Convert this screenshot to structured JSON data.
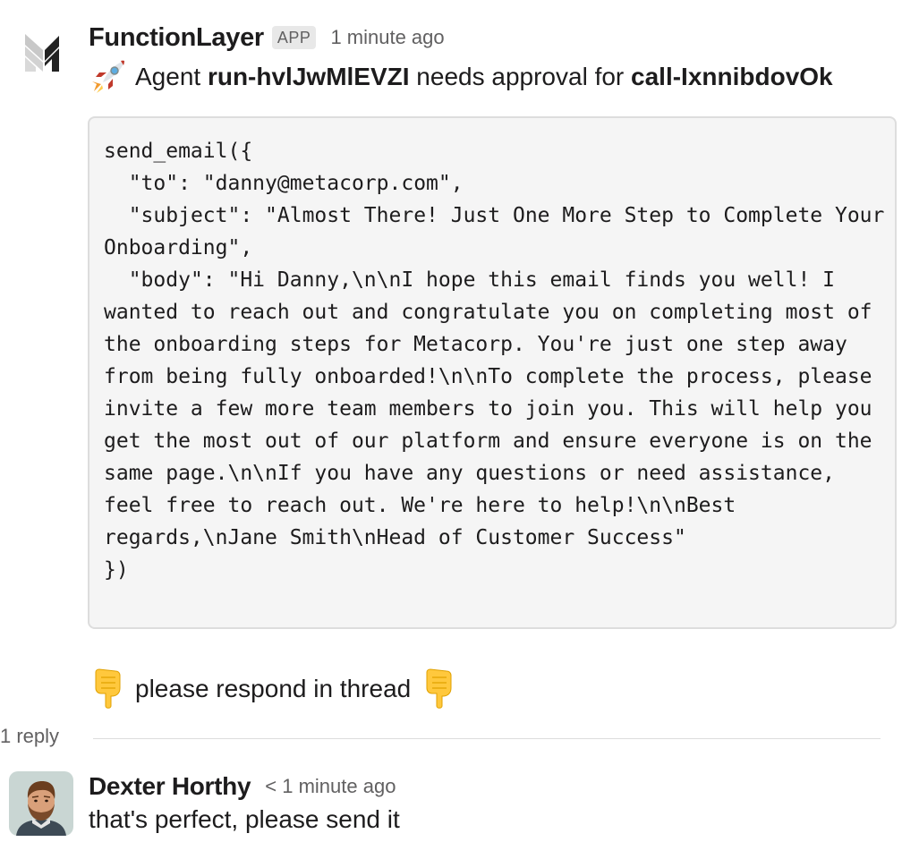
{
  "app_message": {
    "sender": "FunctionLayer",
    "badge": "APP",
    "timestamp": "1 minute ago",
    "avatar_icon": "functionlayer-logo-icon",
    "text": {
      "emoji": "rocket-icon",
      "prefix": "Agent ",
      "run_id": "run-hvlJwMlEVZI",
      "middle": " needs approval for ",
      "call_id": "call-IxnnibdovOk"
    },
    "code": "send_email({\n  \"to\": \"danny@metacorp.com\",\n  \"subject\": \"Almost There! Just One More Step to Complete Your Onboarding\",\n  \"body\": \"Hi Danny,\\n\\nI hope this email finds you well! I wanted to reach out and congratulate you on completing most of the onboarding steps for Metacorp. You're just one step away from being fully onboarded!\\n\\nTo complete the process, please invite a few more team members to join you. This will help you get the most out of our platform and ensure everyone is on the same page.\\n\\nIf you have any questions or need assistance, feel free to reach out. We're here to help!\\n\\nBest regards,\\nJane Smith\\nHead of Customer Success\"\n})",
    "respond_prompt": "please respond in thread",
    "respond_emoji": "pointing-down-hand-icon"
  },
  "thread": {
    "reply_count": "1 reply"
  },
  "reply": {
    "sender": "Dexter Horthy",
    "timestamp": "< 1 minute ago",
    "text": "that's perfect, please send it",
    "avatar_icon": "user-avatar"
  },
  "colors": {
    "text": "#1d1c1d",
    "muted": "#616061",
    "code_bg": "#f5f5f5",
    "code_border": "#dddddd",
    "badge_bg": "#e8e8e8"
  }
}
